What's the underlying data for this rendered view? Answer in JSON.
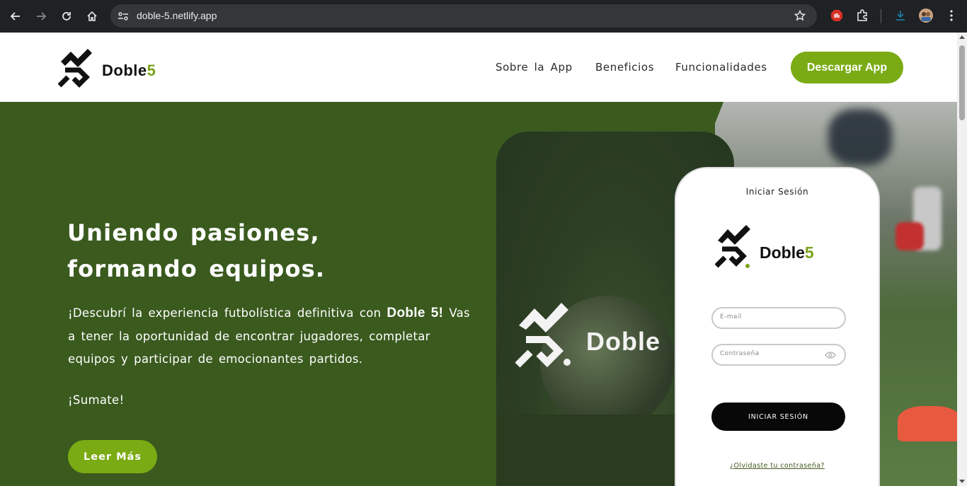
{
  "browser": {
    "url": "doble-5.netlify.app",
    "icons": [
      "back-icon",
      "forward-icon",
      "reload-icon",
      "home-icon",
      "site-info-icon",
      "bookmark-star-icon",
      "adblock-icon",
      "extensions-icon",
      "download-icon",
      "profile-avatar-icon",
      "menu-icon"
    ]
  },
  "header": {
    "logo": {
      "name": "Doble",
      "five": "5"
    },
    "nav": [
      {
        "label": "Sobre la App"
      },
      {
        "label": "Beneficios"
      },
      {
        "label": "Funcionalidades"
      }
    ],
    "cta_label": "Descargar App"
  },
  "hero": {
    "title_line1": "Uniendo pasiones,",
    "title_line2": "formando equipos.",
    "text_before": "¡Descubrí la experiencia futbolística definitiva con",
    "text_brand": "Doble 5!",
    "text_after": "Vas a tener la oportunidad de encontrar jugadores, completar equipos y participar de emocionantes partidos.",
    "sumate": "¡Sumate!",
    "button_label": "Leer Más"
  },
  "promo": {
    "card_logo_text": "Doble"
  },
  "phone": {
    "title": "Iniciar Sesión",
    "logo": {
      "name": "Doble",
      "five": "5"
    },
    "email_placeholder": "E-mail",
    "password_placeholder": "Contraseña",
    "login_label": "INICIAR SESIÓN",
    "forgot_label": "¿Olvidaste tu contraseña?"
  },
  "colors": {
    "brand_green": "#7aab14",
    "hero_bg": "#3a5a1e",
    "chrome_bg": "#202124"
  }
}
